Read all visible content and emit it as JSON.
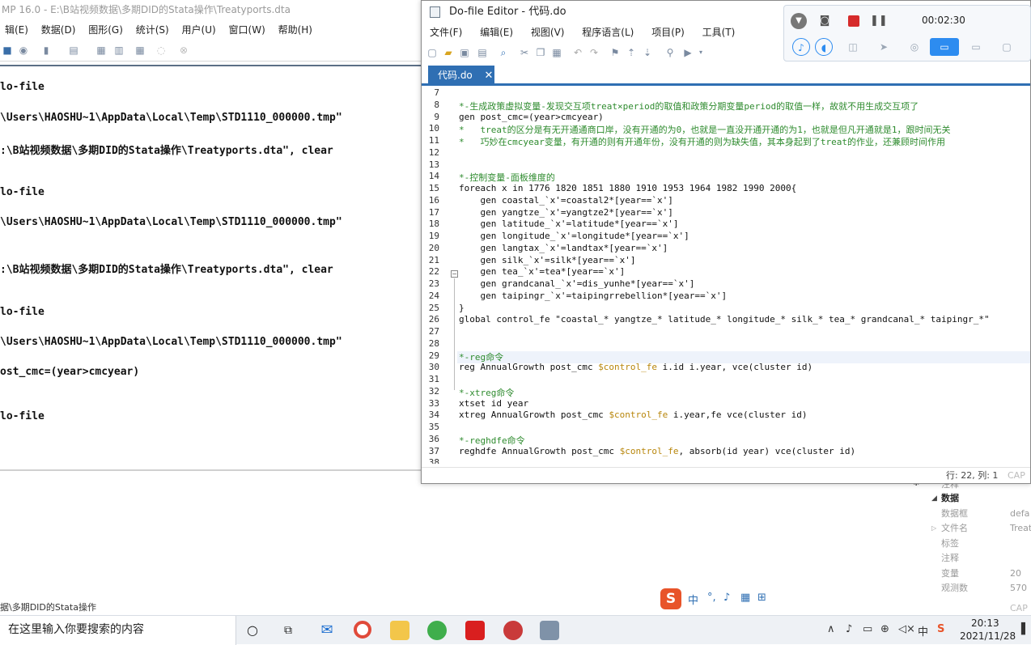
{
  "main_window": {
    "title": "MP 16.0 - E:\\B站视频数据\\多期DID的Stata操作\\Treatyports.dta",
    "menu": [
      "辑(E)",
      "数据(D)",
      "图形(G)",
      "统计(S)",
      "用户(U)",
      "窗口(W)",
      "帮助(H)"
    ],
    "results": [
      "lo-file",
      "\\Users\\HAOSHU~1\\AppData\\Local\\Temp\\STD1110_000000.tmp\"",
      ":\\B站视频数据\\多期DID的Stata操作\\Treatyports.dta\", clear",
      "lo-file",
      "\\Users\\HAOSHU~1\\AppData\\Local\\Temp\\STD1110_000000.tmp\"",
      ":\\B站视频数据\\多期DID的Stata操作\\Treatyports.dta\", clear",
      "lo-file",
      "\\Users\\HAOSHU~1\\AppData\\Local\\Temp\\STD1110_000000.tmp\"",
      "ost_cmc=(year>cmcyear)",
      "lo-file"
    ],
    "status_path": "据\\多期DID的Stata操作"
  },
  "properties": {
    "partial_top": "注释",
    "section": "数据",
    "rows": [
      {
        "key": "数据框",
        "value": "defa"
      },
      {
        "key": "文件名",
        "value": "Treat"
      },
      {
        "key": "标签",
        "value": ""
      },
      {
        "key": "注释",
        "value": ""
      },
      {
        "key": "变量",
        "value": "20"
      },
      {
        "key": "观测数",
        "value": "570"
      }
    ],
    "cap": "CAP"
  },
  "editor": {
    "title": "Do-file Editor - 代码.do",
    "menu": [
      "文件(F)",
      "编辑(E)",
      "视图(V)",
      "程序语言(L)",
      "项目(P)",
      "工具(T)"
    ],
    "tab_label": "代码.do",
    "tab_close": "✕",
    "line_numbers": [
      "7",
      "8",
      "9",
      "10",
      "11",
      "12",
      "13",
      "14",
      "15",
      "16",
      "17",
      "18",
      "19",
      "20",
      "21",
      "22",
      "23",
      "24",
      "25",
      "26",
      "27",
      "28",
      "29",
      "30",
      "31",
      "32",
      "33",
      "34",
      "35",
      "36",
      "37",
      "38"
    ],
    "lines": [
      {
        "type": "blank",
        "text": ""
      },
      {
        "type": "comment",
        "text": "*-生成政策虚拟变量-发现交互项treat×period的取值和政策分期变量period的取值一样，故就不用生成交互项了"
      },
      {
        "type": "code",
        "text": "gen post_cmc=(year>cmcyear)"
      },
      {
        "type": "comment",
        "text": "*   treat的区分是有无开通通商口岸，没有开通的为0，也就是一直没开通开通的为1，也就是但凡开通就是1，跟时间无关"
      },
      {
        "type": "comment",
        "text": "*   巧妙在cmcyear变量，有开通的则有开通年份，没有开通的则为缺失值，其本身起到了treat的作业，还兼顾时间作用"
      },
      {
        "type": "blank",
        "text": ""
      },
      {
        "type": "blank",
        "text": ""
      },
      {
        "type": "comment",
        "text": "*-控制变量-面板维度的"
      },
      {
        "type": "code",
        "text": "foreach x in 1776 1820 1851 1880 1910 1953 1964 1982 1990 2000{"
      },
      {
        "type": "code",
        "text": "    gen coastal_`x'=coastal2*[year==`x']"
      },
      {
        "type": "code",
        "text": "    gen yangtze_`x'=yangtze2*[year==`x']"
      },
      {
        "type": "code",
        "text": "    gen latitude_`x'=latitude*[year==`x']"
      },
      {
        "type": "code",
        "text": "    gen longitude_`x'=longitude*[year==`x']"
      },
      {
        "type": "code",
        "text": "    gen langtax_`x'=landtax*[year==`x']"
      },
      {
        "type": "code",
        "text": "    gen silk_`x'=silk*[year==`x']"
      },
      {
        "type": "code",
        "text": "    gen tea_`x'=tea*[year==`x']"
      },
      {
        "type": "code",
        "text": "    gen grandcanal_`x'=dis_yunhe*[year==`x']"
      },
      {
        "type": "code",
        "text": "    gen taipingr_`x'=taipingrrebellion*[year==`x']"
      },
      {
        "type": "code",
        "text": "}"
      },
      {
        "type": "code",
        "text": "global control_fe \"coastal_* yangtze_* latitude_* longitude_* silk_* tea_* grandcanal_* taipingr_*\""
      },
      {
        "type": "blank",
        "text": ""
      },
      {
        "type": "blank",
        "text": ""
      },
      {
        "type": "comment",
        "text": "*-reg命令"
      },
      {
        "type": "macro",
        "pre": "reg AnnualGrowth post_cmc ",
        "macro": "$control_fe",
        "post": " i.id i.year, vce(cluster id)"
      },
      {
        "type": "blank",
        "text": ""
      },
      {
        "type": "comment",
        "text": "*-xtreg命令"
      },
      {
        "type": "code",
        "text": "xtset id year"
      },
      {
        "type": "macro",
        "pre": "xtreg AnnualGrowth post_cmc ",
        "macro": "$control_fe",
        "post": " i.year,fe vce(cluster id)"
      },
      {
        "type": "blank",
        "text": ""
      },
      {
        "type": "comment",
        "text": "*-reghdfe命令"
      },
      {
        "type": "macro",
        "pre": "reghdfe AnnualGrowth post_cmc ",
        "macro": "$control_fe",
        "post": ", absorb(id year) vce(cluster id)"
      },
      {
        "type": "blank",
        "text": ""
      }
    ],
    "status_pos": "行: 22, 列: 1",
    "status_cap": "CAP"
  },
  "recorder": {
    "timer": "00:02:30"
  },
  "ime": {
    "logo": "S",
    "lang": "中"
  },
  "taskbar": {
    "search_placeholder": "在这里输入你要搜索的内容",
    "time": "20:13",
    "date": "2021/11/28"
  },
  "colors": {
    "tab_blue": "#2f6fb3",
    "comment_green": "#2e8b2e",
    "macro_gold": "#b8860b",
    "record_red": "#d62b2b"
  }
}
